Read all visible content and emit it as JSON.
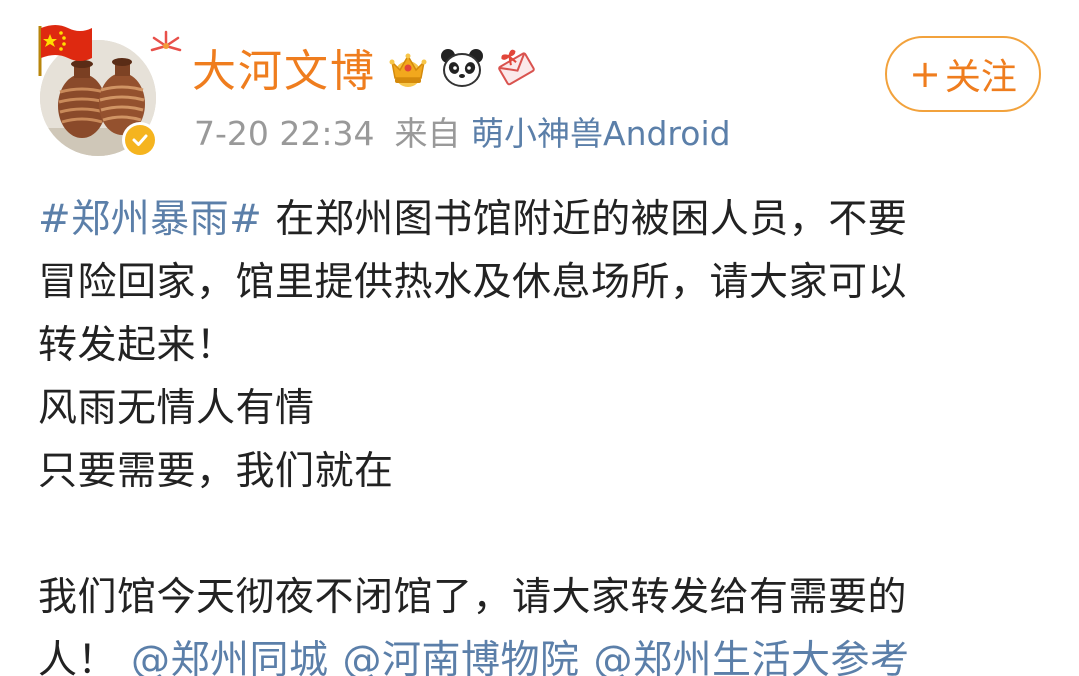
{
  "header": {
    "username": "大河文博",
    "badges": [
      "crown-icon",
      "panda-icon",
      "gift-envelope-icon"
    ],
    "timestamp": "7-20 22:34",
    "source_prefix": "来自",
    "source_app": "萌小神兽Android",
    "follow_label": "关注",
    "follow_plus": "+"
  },
  "post": {
    "topic": "#郑州暴雨#",
    "line1_rest": " 在郑州图书馆附近的被困人员，不要",
    "line2": "冒险回家，馆里提供热水及休息场所，请大家可以",
    "line3": "转发起来！",
    "line4": "风雨无情人有情",
    "line5": "只要需要，我们就在",
    "line6": "我们馆今天彻夜不闭馆了，请大家转发给有需要的",
    "line7": "人！",
    "mentions": [
      "@郑州同城",
      "@河南博物院",
      "@郑州生活大参考"
    ]
  },
  "colors": {
    "username": "#ef7d1e",
    "link": "#5b7fa9",
    "meta": "#999999",
    "text": "#222222",
    "follow_border": "#f2a23c",
    "verified": "#f5b41f"
  }
}
